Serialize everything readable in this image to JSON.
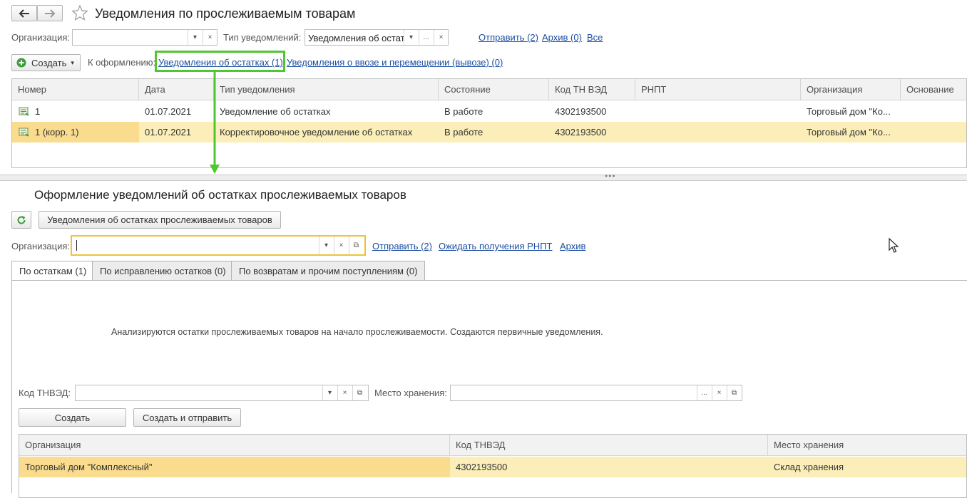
{
  "window": {
    "title": "Уведомления по прослеживаемым товарам"
  },
  "filters": {
    "org_label": "Организация:",
    "org_value": "",
    "type_label": "Тип уведомлений:",
    "type_value": "Уведомления об остат",
    "links": [
      "Отправить (2)",
      "Архив (0)",
      "Все"
    ]
  },
  "toolbar": {
    "create_label": "Создать",
    "pending_label": "К оформлению:",
    "pending_links": [
      "Уведомления об остатках (1)",
      "Уведомления о ввозе и перемещении (вывозе) (0)"
    ]
  },
  "table1": {
    "columns": [
      "Номер",
      "Дата",
      "Тип уведомления",
      "Состояние",
      "Код ТН ВЭД",
      "РНПТ",
      "Организация",
      "Основание"
    ],
    "rows": [
      [
        "1",
        "01.07.2021",
        "Уведомление об остатках",
        "В работе",
        "4302193500",
        "",
        "Торговый дом \"Ко...",
        ""
      ],
      [
        "1 (корр. 1)",
        "01.07.2021",
        "Корректировочное уведомление об остатках",
        "В работе",
        "4302193500",
        "",
        "Торговый дом \"Ко...",
        ""
      ]
    ]
  },
  "panel": {
    "title": "Оформление уведомлений об остатках прослеживаемых товаров",
    "notices_button": "Уведомления об остатках прослеживаемых товаров",
    "org_label": "Организация:",
    "org_value": "",
    "links": [
      "Отправить (2)",
      "Ожидать получения РНПТ",
      "Архив"
    ],
    "tabs": [
      "По остаткам (1)",
      "По исправлению остатков (0)",
      "По возвратам и прочим поступлениям (0)"
    ],
    "info": "Анализируются остатки прослеживаемых товаров на начало прослеживаемости. Создаются первичные уведомления.",
    "tnved_label": "Код ТНВЭД:",
    "tnved_value": "",
    "storage_label": "Место хранения:",
    "storage_value": "",
    "create_button": "Создать",
    "create_send_button": "Создать и отправить"
  },
  "table2": {
    "columns": [
      "Организация",
      "Код ТНВЭД",
      "Место хранения"
    ],
    "rows": [
      [
        "Торговый дом \"Комплексный\"",
        "4302193500",
        "Склад хранения"
      ]
    ]
  },
  "colors": {
    "highlight_frame": "#4fc632",
    "selected_row": "#fbeeb8",
    "selected_cell": "#f9dc8e",
    "link": "#1c4ea1",
    "focus_border": "#f1c232"
  }
}
